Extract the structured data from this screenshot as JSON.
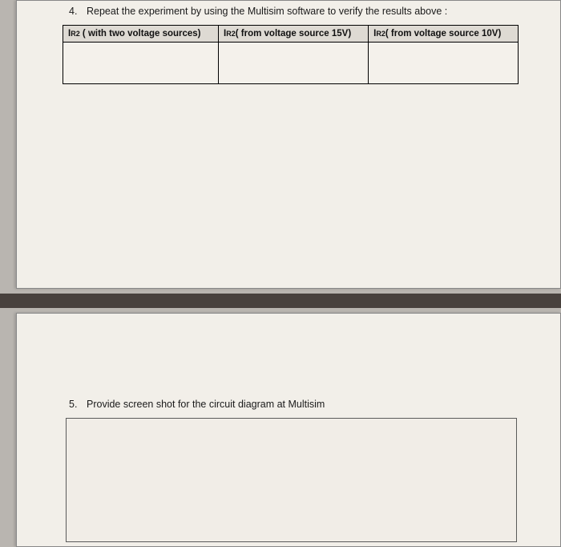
{
  "q4": {
    "number": "4.",
    "text": "Repeat the experiment by using the Multisim software to verify the results above :"
  },
  "table": {
    "headers": [
      {
        "prefix": "I",
        "sub": "R2",
        "suffix": " ( with two voltage sources)"
      },
      {
        "prefix": "I",
        "sub": "R2",
        "suffix": "( from voltage source 15V)"
      },
      {
        "prefix": "I",
        "sub": "R2",
        "suffix": "( from voltage source 10V)"
      }
    ]
  },
  "q5": {
    "number": "5.",
    "text": "Provide screen shot for the circuit diagram at Multisim"
  }
}
